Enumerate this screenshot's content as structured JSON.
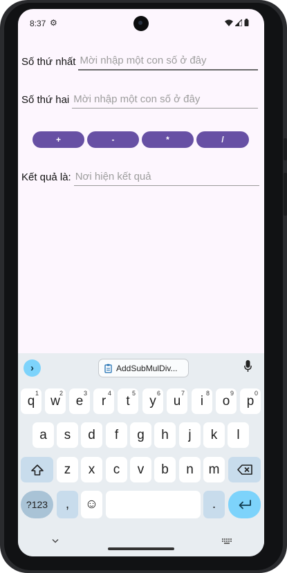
{
  "status_bar": {
    "time": "8:37",
    "gear_icon": "⚙"
  },
  "form": {
    "first_label": "Số thứ nhất",
    "first_placeholder": "Mời nhập một con số ở đây",
    "second_label": "Số thứ hai",
    "second_placeholder": "Mời nhập một con số ở đây",
    "result_label": "Kết quả là:",
    "result_placeholder": "Nơi hiện kết quả"
  },
  "operations": [
    "+",
    "-",
    "*",
    "/"
  ],
  "keyboard": {
    "clipboard_chip": "AddSubMulDiv...",
    "row1": [
      {
        "key": "q",
        "num": "1"
      },
      {
        "key": "w",
        "num": "2"
      },
      {
        "key": "e",
        "num": "3"
      },
      {
        "key": "r",
        "num": "4"
      },
      {
        "key": "t",
        "num": "5"
      },
      {
        "key": "y",
        "num": "6"
      },
      {
        "key": "u",
        "num": "7"
      },
      {
        "key": "i",
        "num": "8"
      },
      {
        "key": "o",
        "num": "9"
      },
      {
        "key": "p",
        "num": "0"
      }
    ],
    "row2": [
      "a",
      "s",
      "d",
      "f",
      "g",
      "h",
      "j",
      "k",
      "l"
    ],
    "row3": [
      "z",
      "x",
      "c",
      "v",
      "b",
      "n",
      "m"
    ],
    "symbols_label": "?123",
    "comma": ",",
    "period": ".",
    "emoji": "☺"
  },
  "colors": {
    "accent": "#6750a4",
    "screen_bg": "#fdf6fe",
    "keyboard_bg": "#e8edf1",
    "enter_key": "#7dd3fb"
  }
}
